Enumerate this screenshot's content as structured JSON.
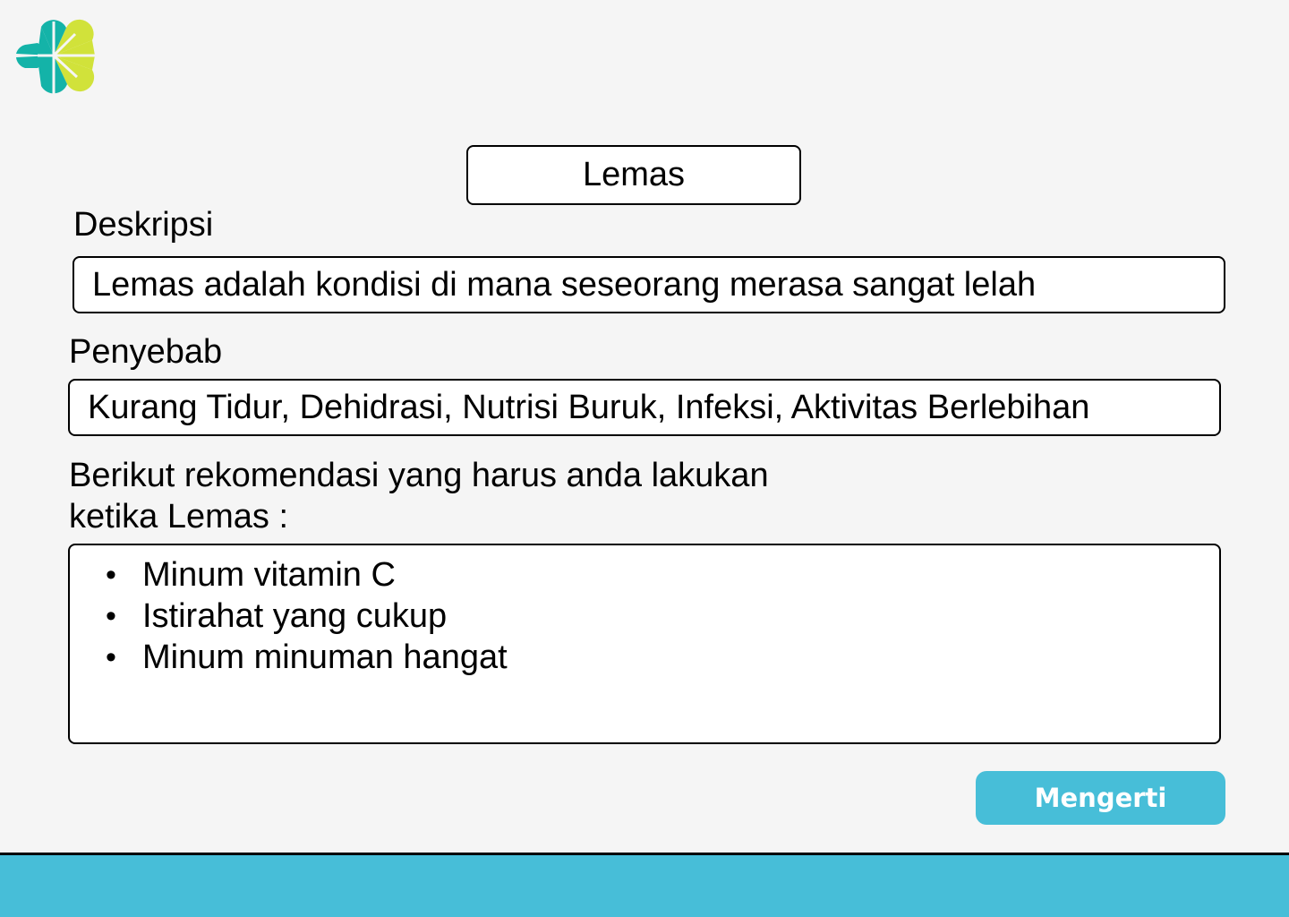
{
  "header": {
    "logo_icon": "clover-cross-logo-icon"
  },
  "colors": {
    "accent": "#47bed8",
    "logo_teal": "#14b3a8",
    "logo_lime": "#d1e23a",
    "background": "#f5f5f5"
  },
  "main": {
    "title": "Lemas",
    "description_label": "Deskripsi",
    "description_text": "Lemas adalah kondisi di mana seseorang merasa sangat lelah",
    "cause_label": "Penyebab",
    "cause_text": "Kurang Tidur, Dehidrasi, Nutrisi Buruk, Infeksi, Aktivitas Berlebihan",
    "recommendation_line1": "Berikut rekomendasi yang harus anda lakukan",
    "recommendation_line2": "ketika Lemas :",
    "recommendations": [
      "Minum vitamin C",
      "Istirahat yang cukup",
      "Minum minuman hangat"
    ],
    "confirm_button": "Mengerti"
  }
}
